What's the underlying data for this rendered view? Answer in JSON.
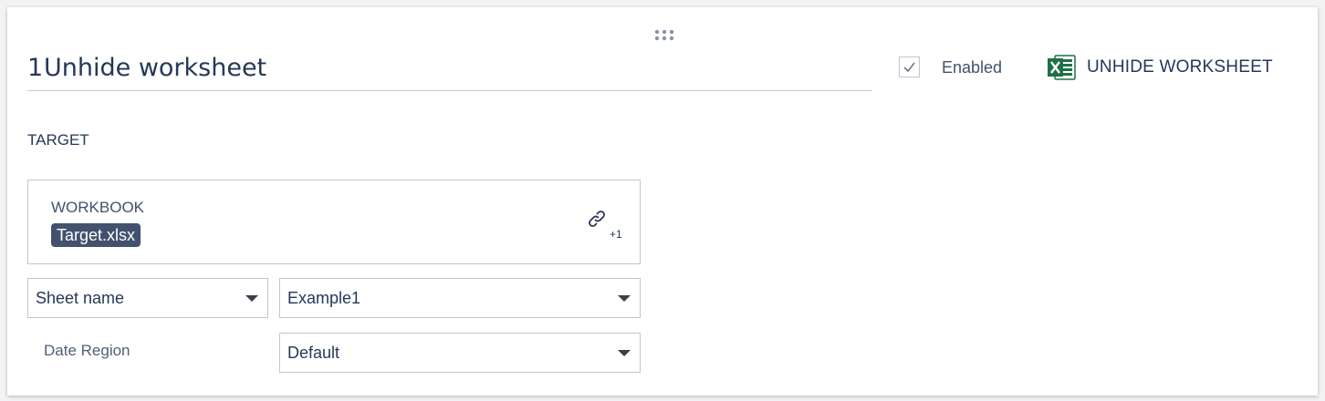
{
  "step": {
    "number": "1",
    "title": "Unhide worksheet",
    "enabled_label": "Enabled",
    "enabled_checked": true,
    "action_icon": "excel-icon",
    "action_name": "UNHIDE WORKSHEET"
  },
  "target": {
    "section_label": "TARGET",
    "workbook_label": "WORKBOOK",
    "workbook_file": "Target.xlsx",
    "link_icon": "link-icon",
    "link_count": "+1"
  },
  "sheet": {
    "mode": "Sheet name",
    "value": "Example1"
  },
  "date_region": {
    "label": "Date Region",
    "value": "Default"
  },
  "colors": {
    "text_primary": "#253858",
    "chip_background": "#42526e",
    "excel_green": "#1e7145",
    "border": "#c3c6cc"
  }
}
